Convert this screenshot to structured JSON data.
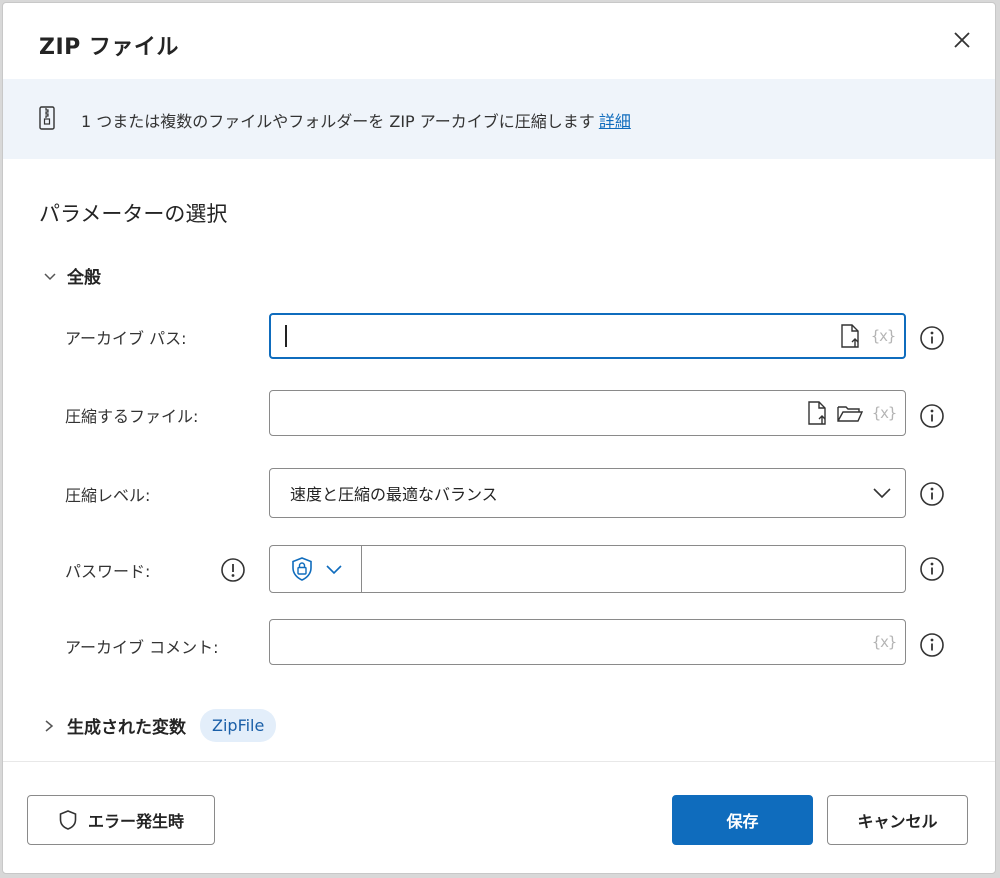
{
  "dialog": {
    "title": "ZIP ファイル",
    "info": {
      "text": "1 つまたは複数のファイルやフォルダーを ZIP アーカイブに圧縮します",
      "link": "詳細"
    },
    "section_title": "パラメーターの選択",
    "general": {
      "header": "全般",
      "fields": {
        "archive_path": {
          "label": "アーカイブ パス:",
          "value": ""
        },
        "files_to_zip": {
          "label": "圧縮するファイル:",
          "value": ""
        },
        "compression_level": {
          "label": "圧縮レベル:",
          "selected": "速度と圧縮の最適なバランス"
        },
        "password": {
          "label": "パスワード:",
          "value": ""
        },
        "archive_comment": {
          "label": "アーカイブ コメント:",
          "value": ""
        }
      },
      "var_icon_text": "{x}"
    },
    "variables": {
      "header": "生成された変数",
      "chip": "ZipFile"
    },
    "buttons": {
      "on_error": "エラー発生時",
      "save": "保存",
      "cancel": "キャンセル"
    },
    "colors": {
      "accent": "#0f6cbd",
      "info_band": "#eff4fa",
      "chip_bg": "#e3eefa"
    }
  }
}
